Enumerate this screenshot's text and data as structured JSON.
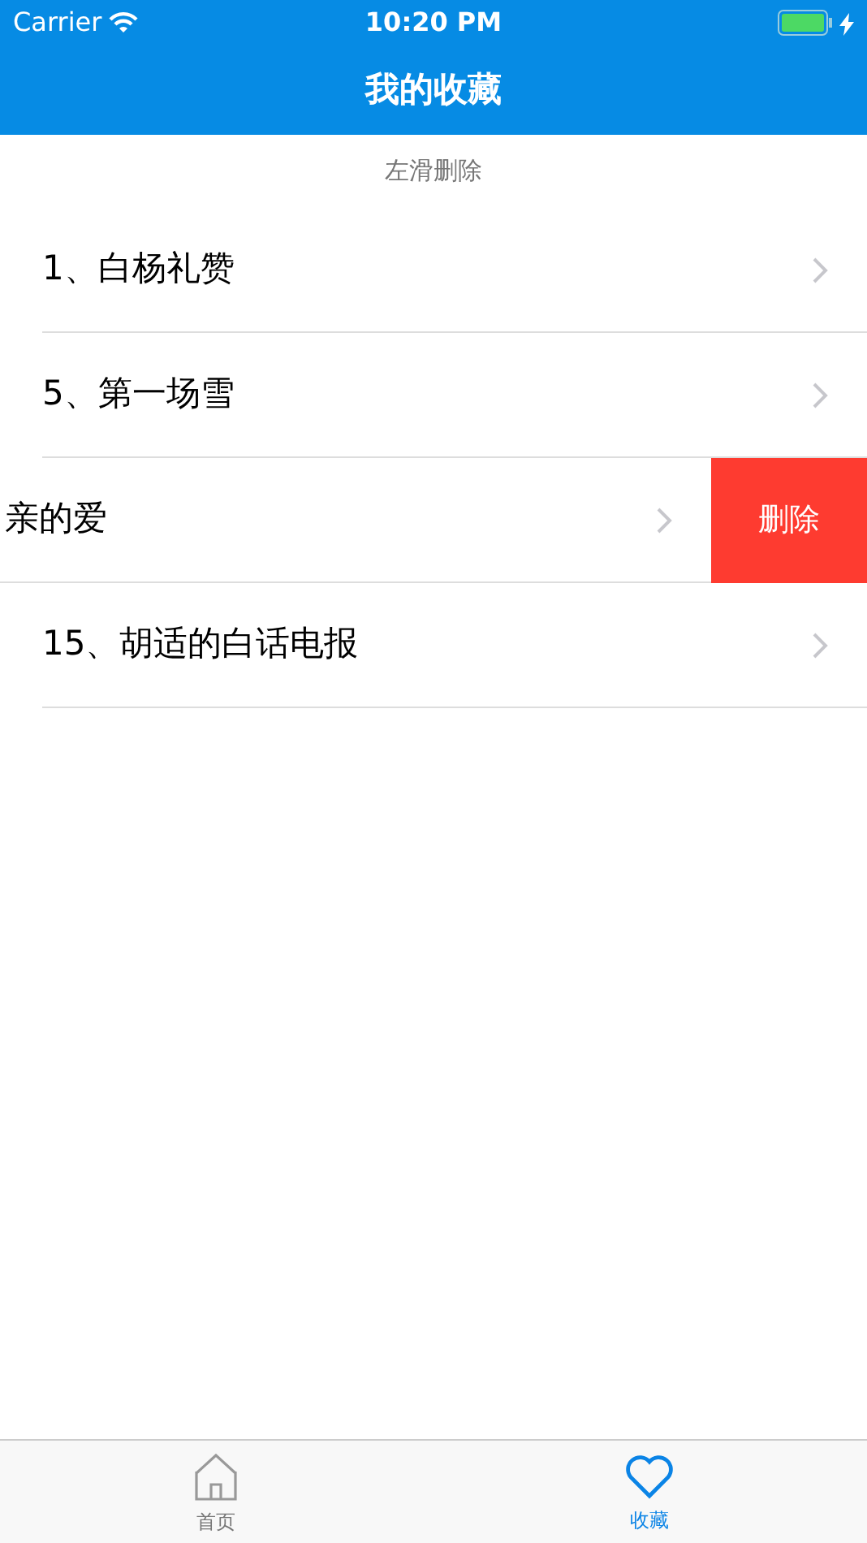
{
  "status_bar": {
    "carrier": "Carrier",
    "time": "10:20 PM",
    "charging": true
  },
  "nav_bar": {
    "title": "我的收藏"
  },
  "hint": "左滑删除",
  "rows": [
    {
      "title": "1、白杨礼赞",
      "swiped": false
    },
    {
      "title": "5、第一场雪",
      "swiped": false
    },
    {
      "title": "亲的爱",
      "swiped": true,
      "action": "删除"
    },
    {
      "title": "15、胡适的白话电报",
      "swiped": false
    }
  ],
  "tab_bar": [
    {
      "label": "首页",
      "kind": "home",
      "selected": false
    },
    {
      "label": "收藏",
      "kind": "heart",
      "selected": true
    }
  ]
}
